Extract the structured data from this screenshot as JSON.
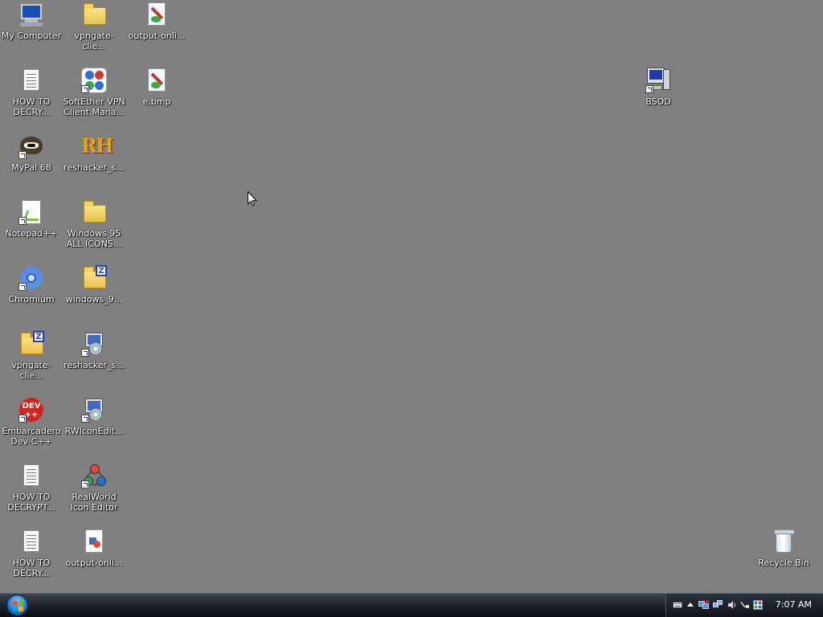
{
  "desktop": {
    "icons": [
      {
        "key": "my_computer",
        "label": "My Computer"
      },
      {
        "key": "vpngate_folder",
        "label": "vpngate-clie..."
      },
      {
        "key": "output_online_top",
        "label": "output-onli..."
      },
      {
        "key": "how_to_decry_1",
        "label": "HOW TO DECRY..."
      },
      {
        "key": "softether",
        "label": "SoftEther VPN Client Mana..."
      },
      {
        "key": "e_bmp",
        "label": "e.bmp"
      },
      {
        "key": "bsod",
        "label": "BSOD"
      },
      {
        "key": "mypal",
        "label": "MyPal 68"
      },
      {
        "key": "reshacker_rh",
        "label": "reshacker_s..."
      },
      {
        "key": "notepadpp",
        "label": "Notepad++"
      },
      {
        "key": "win95_icons",
        "label": "Windows 95 ALL ICONS..."
      },
      {
        "key": "chromium",
        "label": "Chromium"
      },
      {
        "key": "windows9_zip",
        "label": "windows_9..."
      },
      {
        "key": "vpngate_zip",
        "label": "vpngate-clie..."
      },
      {
        "key": "reshacker_setup",
        "label": "reshacker_s..."
      },
      {
        "key": "devcpp",
        "label": "Embarcadero Dev-C++"
      },
      {
        "key": "rwiconedit",
        "label": "RWIconEdit..."
      },
      {
        "key": "how_to_decrypt",
        "label": "HOW TO DECRYPT..."
      },
      {
        "key": "realworld",
        "label": "RealWorld Icon Editor"
      },
      {
        "key": "how_to_decry_2",
        "label": "HOW TO DECRY..."
      },
      {
        "key": "output_online_bottom",
        "label": "output-onli..."
      },
      {
        "key": "recycle_bin",
        "label": "Recycle Bin"
      }
    ],
    "devcpp_badge": "DEV",
    "devcpp_badge_sub": "++",
    "reshacker_badge": "RH",
    "zip_badge": "Z"
  },
  "taskbar": {
    "clock": "7:07 AM"
  },
  "colors": {
    "desktop_background": "#808080",
    "taskbar": "#1b2027",
    "label_text": "#ffffff"
  }
}
